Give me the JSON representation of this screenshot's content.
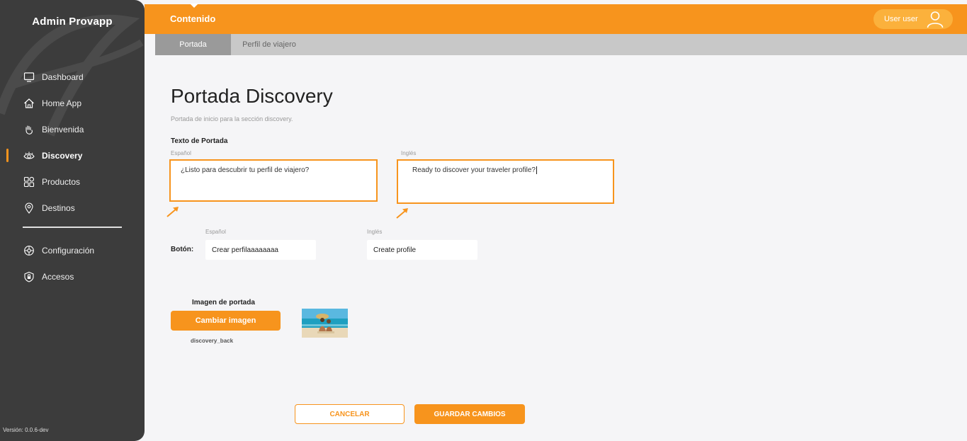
{
  "sidebar": {
    "brand": "Admin Provapp",
    "items": [
      {
        "label": "Dashboard",
        "icon": "monitor-icon"
      },
      {
        "label": "Home App",
        "icon": "home-icon"
      },
      {
        "label": "Bienvenida",
        "icon": "wave-hand-icon"
      },
      {
        "label": "Discovery",
        "icon": "eye-icon",
        "active": true
      },
      {
        "label": "Productos",
        "icon": "grid-icon"
      },
      {
        "label": "Destinos",
        "icon": "location-pin-icon"
      }
    ],
    "secondary": [
      {
        "label": "Configuración",
        "icon": "gear-icon"
      },
      {
        "label": "Accesos",
        "icon": "shield-lock-icon"
      }
    ],
    "version": "Versión: 0.0.6-dev"
  },
  "header": {
    "title": "Contenido",
    "user": "User user"
  },
  "tabs": [
    {
      "label": "Portada",
      "active": true
    },
    {
      "label": "Perfil de viajero",
      "active": false
    }
  ],
  "main": {
    "title": "Portada Discovery",
    "subtitle": "Portada de inicio para la sección discovery.",
    "cover_text_label": "Texto de Portada",
    "es_label": "Español",
    "en_label": "Inglés",
    "cover_text_es": "¿Listo para descubrir tu perfil de viajero?",
    "cover_text_en": "Ready to discover your traveler profile?",
    "button_label": "Botón:",
    "button_es_label": "Español",
    "button_en_label": "Inglés",
    "button_es": "Crear perfilaaaaaaaa",
    "button_en": "Create profile",
    "image_label": "Imagen de portada",
    "change_image": "Cambiar imagen",
    "image_name": "discovery_back",
    "cancel": "CANCELAR",
    "save": "GUARDAR CAMBIOS"
  },
  "colors": {
    "accent": "#f7941d",
    "sidebar_bg": "#3c3c3c",
    "tabs_bg": "#c8c8c8"
  }
}
